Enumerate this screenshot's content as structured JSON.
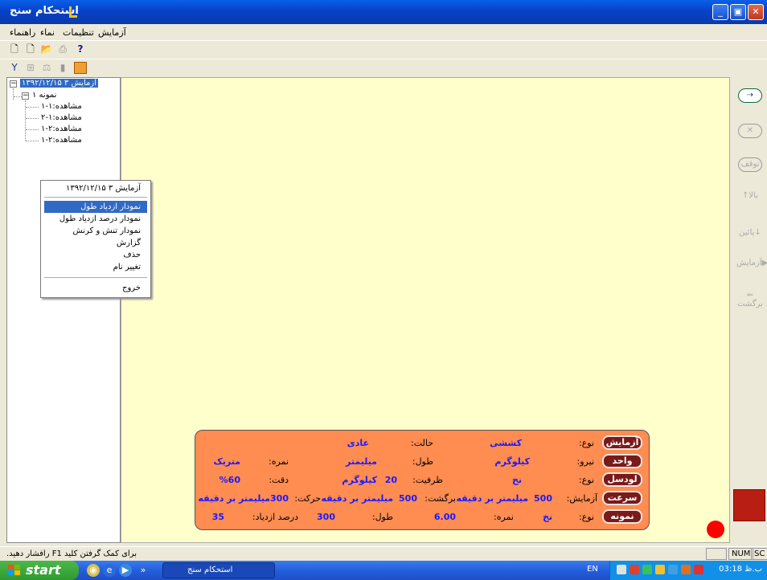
{
  "window": {
    "title": "استحکام سنج"
  },
  "menu": {
    "items": [
      "آزمایش",
      "تنظیمات",
      "نماء",
      "راهنماء"
    ]
  },
  "tree": {
    "root": "آزمایش ۳ ۱۳۹۲/۱۲/۱۵",
    "sample": "نمونه ۱",
    "observations": [
      "مشاهده:۱-۱",
      "مشاهده:۱-۲",
      "مشاهده:۲-۱",
      "مشاهده:۲-۱"
    ]
  },
  "context_menu": {
    "header": "آزمایش ۳ ۱۳۹۲/۱۲/۱۵",
    "items": [
      "نمودار ازدیاد طول",
      "نمودار درصد ازدیاد طول",
      "نمودار تنش و کرنش",
      "گزارش",
      "حذف",
      "تغییر نام"
    ],
    "exit": "خروج"
  },
  "side_buttons": {
    "start": "شروع",
    "stop": "توقف",
    "up": "بالا",
    "down": "پائین",
    "test": "آزمایش",
    "back": "برگشت"
  },
  "info_panel": {
    "test": {
      "chip": "آزمایش",
      "type_label": "نوع:",
      "type_value": "کششی",
      "state_label": "حالت:",
      "state_value": "عادی"
    },
    "unit": {
      "chip": "واحد",
      "force_label": "نیرو:",
      "force_value": "کیلوگرم",
      "length_label": "طول:",
      "length_value": "میلیمتر",
      "score_label": "نمره:",
      "score_value": "متریک"
    },
    "loadcell": {
      "chip": "لودسل",
      "type_label": "نوع:",
      "type_value": "نخ",
      "capacity_label": "ظرفیت:",
      "capacity_value": "20",
      "capacity_unit": "کیلوگرم",
      "accuracy_label": "دقت:",
      "accuracy_value": "%60"
    },
    "speed": {
      "chip": "سرعت",
      "test_label": "آزمایش:",
      "test_value": "500",
      "test_unit": "میلیمتر بر دقیقه",
      "return_label": "برگشت:",
      "return_value": "500",
      "return_unit": "میلیمتر بر دقیقه",
      "move_label": "حرکت:",
      "move_value": "300میلیمتر بر دقیقه"
    },
    "sample": {
      "chip": "نمونه",
      "type_label": "نوع:",
      "type_value": "نخ",
      "score_label": "نمره:",
      "score_value": "6.00",
      "length_label": "طول:",
      "length_value": "300",
      "elong_label": "درصد ازدیاد:",
      "elong_value": "35"
    }
  },
  "status": {
    "help": "برای کمک گرفتن کلید F1 رافشار دهید.",
    "num": "NUM",
    "scrl": "SC"
  },
  "taskbar": {
    "start": "start",
    "task": "استحکام سنج",
    "lang": "EN",
    "clock": "03:18 ب.ظ"
  },
  "colors": {
    "main_bg": "#ffffcc",
    "panel_bg": "#ff8c50",
    "chip_bg": "#7a1a1a",
    "value": "#1a1aff",
    "titlebar": "#0842c9"
  }
}
